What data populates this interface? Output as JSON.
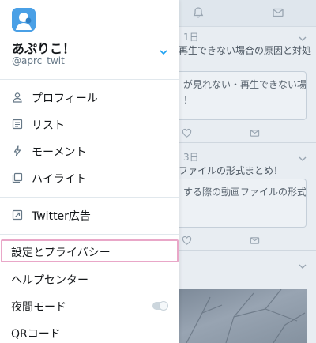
{
  "colors": {
    "accent": "#1da1f2",
    "highlight_border": "#e9a7c8",
    "drawer_bg": "#ffffff",
    "overlay_bg": "#e8edf2"
  },
  "background_timeline": {
    "top_icons": [
      "bell-icon",
      "mail-icon"
    ],
    "tweets": [
      {
        "date": "1日",
        "headline": "再生できない場合の原因と対処",
        "quote_lines": [
          "が見れない・再生できない場",
          "！"
        ]
      },
      {
        "date": "3日",
        "headline": "ファイルの形式まとめ！",
        "quote_lines": [
          "する際の動画ファイルの形式",
          ""
        ]
      }
    ]
  },
  "drawer": {
    "app_icon": "app-avatar-icon",
    "display_name": "あぷりこ！",
    "handle": "@aprc_twit",
    "menu": [
      {
        "label": "プロフィール",
        "icon": "person-icon"
      },
      {
        "label": "リスト",
        "icon": "list-icon"
      },
      {
        "label": "モーメント",
        "icon": "lightning-icon"
      },
      {
        "label": "ハイライト",
        "icon": "highlight-icon"
      }
    ],
    "ads_item": {
      "label": "Twitter広告",
      "icon": "external-link-icon"
    },
    "settings_items": [
      {
        "label": "設定とプライバシー"
      },
      {
        "label": "ヘルプセンター"
      },
      {
        "label": "夜間モード"
      },
      {
        "label": "QRコード"
      }
    ],
    "night_mode_enabled": false
  }
}
